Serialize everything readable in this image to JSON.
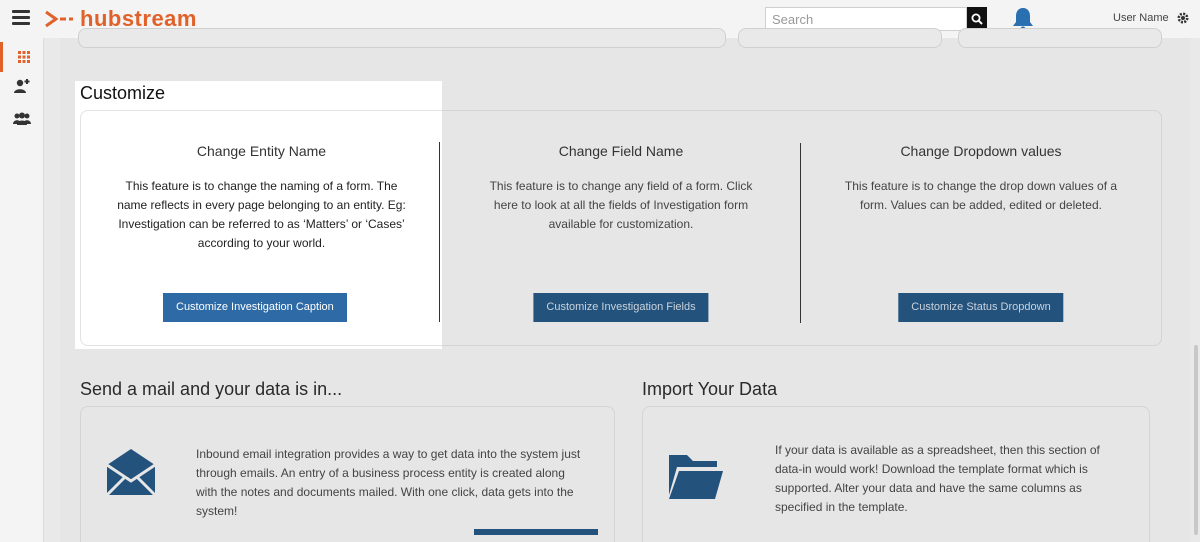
{
  "header": {
    "brand": "hubstream",
    "search": {
      "placeholder": "Search",
      "value": ""
    },
    "user_name": "User Name"
  },
  "colors": {
    "brand": "#e0622a",
    "primary_button": "#2d6aa6",
    "dim_button": "#23527c"
  },
  "sidebar": {
    "items": [
      {
        "icon": "dashboard-grid-icon",
        "active": true
      },
      {
        "icon": "user-assign-icon",
        "active": false
      },
      {
        "icon": "group-icon",
        "active": false
      }
    ]
  },
  "customize": {
    "title": "Customize",
    "features": [
      {
        "title": "Change Entity Name",
        "description": "This feature is to change the naming of a form. The name reflects in every page belonging to an entity. Eg: Investigation can be referred to as ‘Matters’ or ‘Cases’ according to your world.",
        "button": "Customize Investigation Caption"
      },
      {
        "title": "Change Field Name",
        "description": "This feature is to change any field of a form. Click here to look at all the fields of Investigation form available for customization.",
        "button": "Customize Investigation Fields"
      },
      {
        "title": "Change Dropdown values",
        "description": "This feature is to change the drop down values of a form. Values can be added, edited or deleted.",
        "button": "Customize Status Dropdown"
      }
    ]
  },
  "mail": {
    "title": "Send a mail and your data is in...",
    "description": "Inbound email integration provides a way to get data into the system just through emails. An entry of a business process entity is created along with the notes and documents mailed. With one click, data gets into the system!"
  },
  "import": {
    "title": "Import Your Data",
    "description": "If your data is available as a spreadsheet, then this section of data-in would work! Download the template format which is supported. Alter your data and have the same columns as specified in the template."
  }
}
